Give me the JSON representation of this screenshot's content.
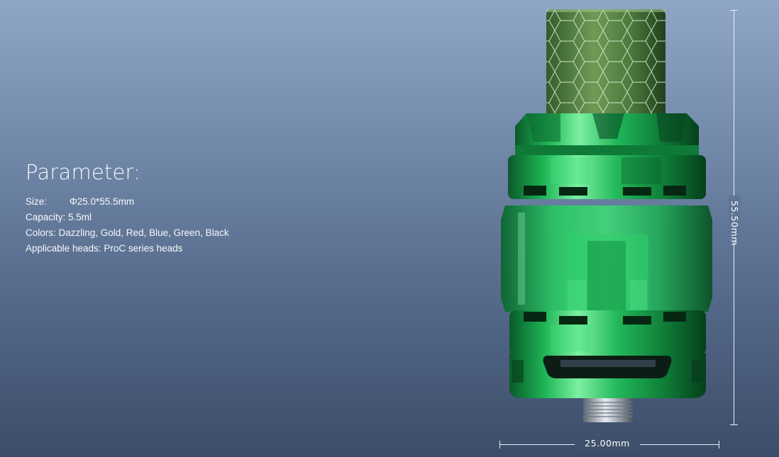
{
  "parameters": {
    "title": "Parameter:",
    "size_label": "Size:",
    "size_value": "Φ25.0*55.5mm",
    "capacity": "Capacity: 5.5ml",
    "colors": "Colors: Dazzling, Gold, Red, Blue, Green, Black",
    "heads": "Applicable heads: ProC series heads"
  },
  "dimensions": {
    "height": "55.50mm",
    "width": "25.00mm"
  },
  "product": {
    "name": "green-sub-ohm-tank",
    "main_color": "#1fb553"
  }
}
